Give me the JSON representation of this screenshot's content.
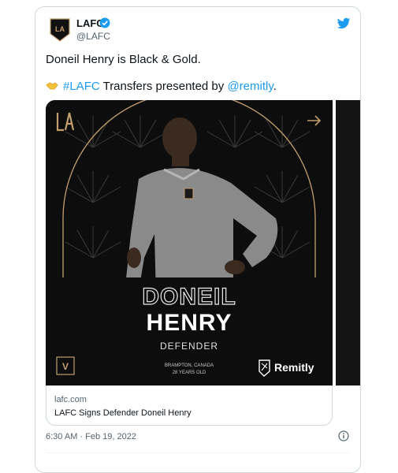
{
  "tweet": {
    "author_name": "LAFC",
    "author_handle": "@LAFC",
    "text_line1": "Doneil Henry is Black & Gold.",
    "hashtag": "#LAFC",
    "text_mid": " Transfers presented by ",
    "mention": "@remitly",
    "text_end": ".",
    "timestamp": "6:30 AM · Feb 19, 2022"
  },
  "graphic": {
    "first_name": "DONEIL",
    "last_name": "HENRY",
    "position": "DEFENDER",
    "hometown": "BRAMPTON, CANADA",
    "age": "28 YEARS OLD",
    "sponsor": "Remitly",
    "badge_letter": "V"
  },
  "link_card": {
    "domain": "lafc.com",
    "title": "LAFC Signs Defender Doneil Henry"
  },
  "colors": {
    "accent": "#1d9bf0",
    "gold": "#c39e6d",
    "background_dark": "#0d0d0d"
  },
  "icons": [
    "lafc-logo-icon",
    "verified-icon",
    "twitter-bird-icon",
    "handshake-icon",
    "arrow-right-icon",
    "remitly-logo-icon",
    "info-icon"
  ]
}
